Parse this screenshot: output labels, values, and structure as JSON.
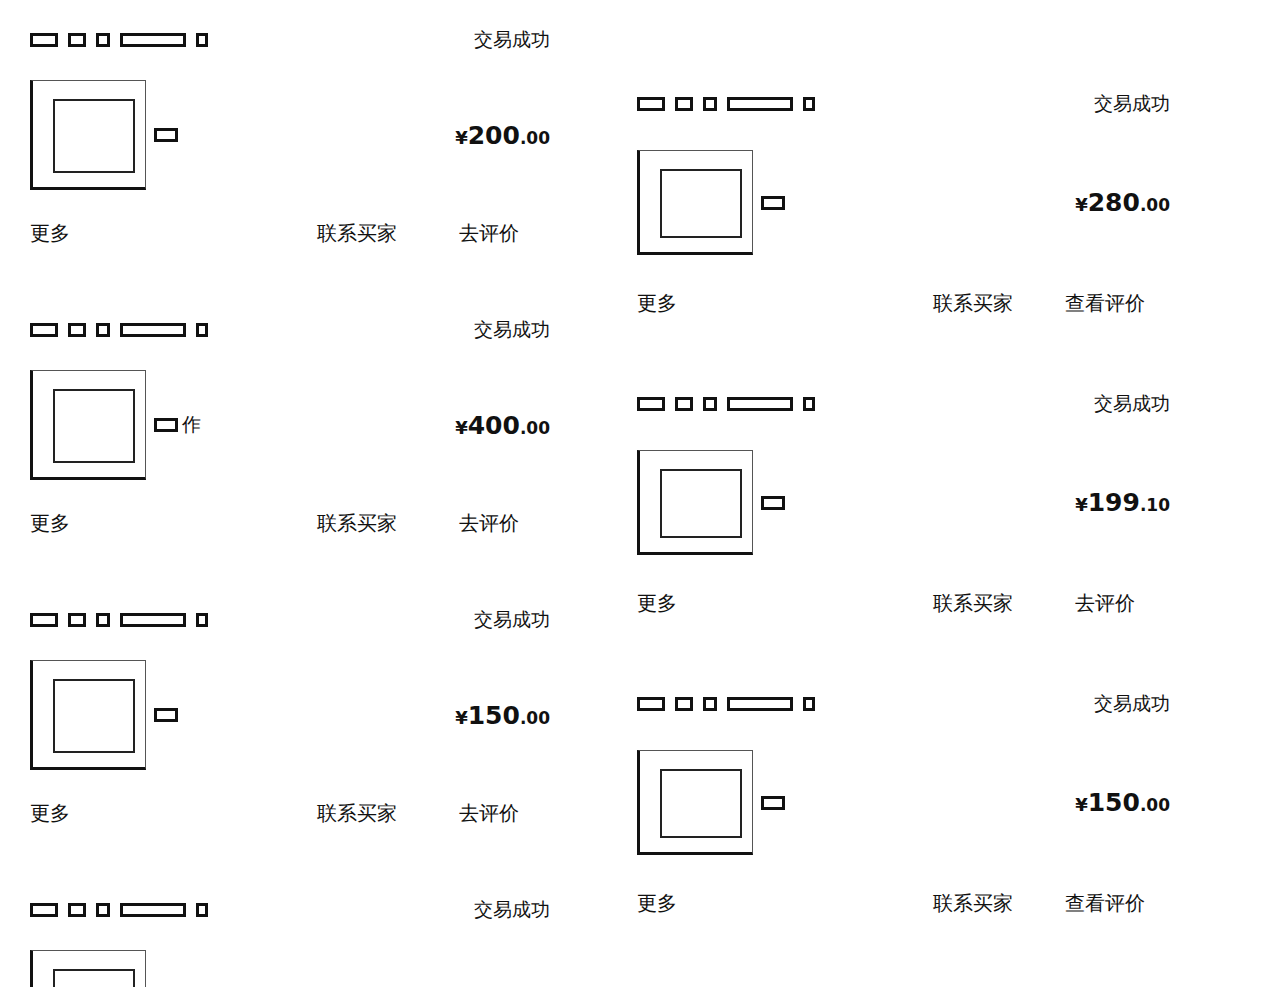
{
  "columns": [
    {
      "orders": [
        {
          "status": "交易成功",
          "price": {
            "symbol": "¥",
            "integer": "200",
            "decimal": ".00"
          },
          "caption": "",
          "actions": [
            "更多",
            "联系买家",
            "去评价"
          ]
        },
        {
          "status": "交易成功",
          "price": {
            "symbol": "¥",
            "integer": "400",
            "decimal": ".00"
          },
          "caption": "作",
          "actions": [
            "更多",
            "联系买家",
            "去评价"
          ]
        },
        {
          "status": "交易成功",
          "price": {
            "symbol": "¥",
            "integer": "150",
            "decimal": ".00"
          },
          "caption": "",
          "actions": [
            "更多",
            "联系买家",
            "去评价"
          ]
        },
        {
          "status": "交易成功",
          "price": null,
          "caption": "",
          "actions": []
        }
      ]
    },
    {
      "orders": [
        {
          "status": "交易成功",
          "price": {
            "symbol": "¥",
            "integer": "280",
            "decimal": ".00"
          },
          "caption": "",
          "actions": [
            "更多",
            "联系买家",
            "查看评价"
          ]
        },
        {
          "status": "交易成功",
          "price": {
            "symbol": "¥",
            "integer": "199",
            "decimal": ".10"
          },
          "caption": "",
          "actions": [
            "更多",
            "联系买家",
            "去评价"
          ]
        },
        {
          "status": "交易成功",
          "price": {
            "symbol": "¥",
            "integer": "150",
            "decimal": ".00"
          },
          "caption": "",
          "actions": [
            "更多",
            "联系买家",
            "查看评价"
          ]
        }
      ]
    }
  ]
}
